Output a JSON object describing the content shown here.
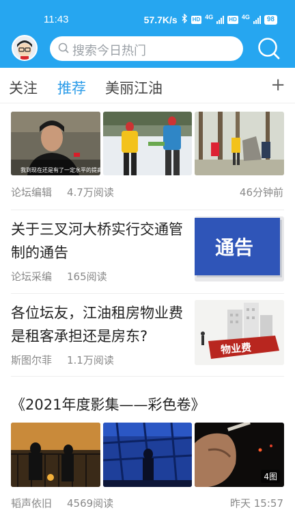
{
  "status_bar": {
    "time": "11:43",
    "speed": "57.7K/s",
    "network": "4G",
    "hd": "HD",
    "battery": "98"
  },
  "header": {
    "search_placeholder": "搜索今日热门",
    "accent_color": "#26a6f0"
  },
  "tabs": [
    {
      "label": "关注"
    },
    {
      "label": "推荐"
    },
    {
      "label": "美丽江油"
    }
  ],
  "tab_add": "+",
  "feed": [
    {
      "author": "论坛编辑",
      "reads": "4.7万阅读",
      "time": "46分钟前",
      "image_caption": "我到现在还是有了一定水平的提高"
    },
    {
      "title": "关于三叉河大桥实行交通管制的通告",
      "author": "论坛采编",
      "reads": "165阅读",
      "thumb_text": "通告"
    },
    {
      "title": "各位坛友，江油租房物业费是租客承担还是房东?",
      "author": "斯图尔菲",
      "reads": "1.1万阅读",
      "thumb_text": "物业费"
    },
    {
      "title": "《2021年度影集——彩色卷》",
      "author": "韬声依旧",
      "reads": "4569阅读",
      "time": "昨天 15:57",
      "image_count": "4图"
    }
  ]
}
